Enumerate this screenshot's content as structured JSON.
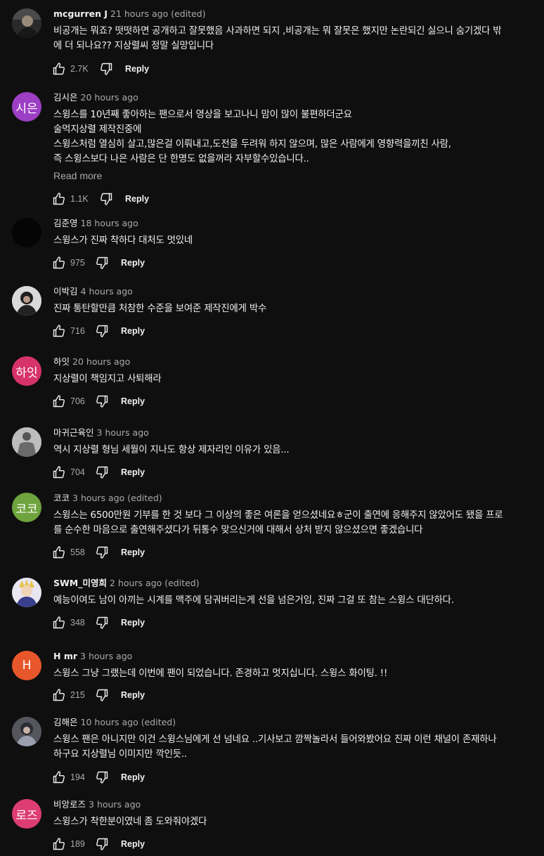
{
  "comments": [
    {
      "author": "mcgurren J",
      "time": "21 hours ago (edited)",
      "lines": [
        "비공개는 뭐죠? 떳떳하면 공개하고 잘못했음 사과하면 되지 ,비공개는 뭐 잘못은 했지만 논란되긴 싫으니 숨기겠다 밖",
        "에 더 되나요?? 지상렬씨 정말 실망입니다"
      ],
      "likes": "2.7K",
      "reply": "Reply",
      "avatar_text": "",
      "avatar_color": "#3a3a3a"
    },
    {
      "author": "김시은",
      "time": "20 hours ago",
      "lines": [
        "스윙스를 10년째 좋아하는 팬으로서 영상을 보고나니 맘이 많이 불편하더군요",
        "술먹지상렬 제작진중에",
        "스윙스처럼 열심히 살고,많은걸 이뤄내고,도전을 두려워 하지 않으며, 많은 사람에게 영향력을끼친 사람,",
        "즉 스윙스보다 나은 사람은 단 한명도 없을꺼라 자부할수있습니다.."
      ],
      "read_more": "Read more",
      "likes": "1.1K",
      "reply": "Reply",
      "avatar_text": "시은",
      "avatar_color": "#9c3fc4"
    },
    {
      "author": "김준영",
      "time": "18 hours ago",
      "lines": [
        "스윙스가 진짜 착하다 대처도 멋있네"
      ],
      "likes": "975",
      "reply": "Reply",
      "avatar_text": "",
      "avatar_color": "#050505"
    },
    {
      "author": "이박김",
      "time": "4 hours ago",
      "lines": [
        "진짜 통탄할만큼 처참한 수준을 보여준 제작진에게 박수"
      ],
      "likes": "716",
      "reply": "Reply",
      "avatar_text": "",
      "avatar_color": "#d8d8d8"
    },
    {
      "author": "하잇",
      "time": "20 hours ago",
      "lines": [
        "지상렬이 책임지고 사퇴해라"
      ],
      "likes": "706",
      "reply": "Reply",
      "avatar_text": "하잇",
      "avatar_color": "#d7336b"
    },
    {
      "author": "마귀근육인",
      "time": "3 hours ago",
      "lines": [
        "역시 지상렬 형님 세월이 지나도 항상 제자리인 이유가 있음..."
      ],
      "likes": "704",
      "reply": "Reply",
      "avatar_text": "",
      "avatar_color": "#8a8a8a"
    },
    {
      "author": "코코",
      "time": "3 hours ago (edited)",
      "lines": [
        "스윙스는 6500만원 기부를 한 것 보다 그 이상의 좋은 여론을 얻으셨네요ㅎ군이 출연에 응해주지 않았어도 됐을 프로",
        "를 순수한 마음으로 출연해주셨다가 뒤통수 맞으신거에 대해서 상처 받지 않으셨으면 좋겠습니다"
      ],
      "likes": "558",
      "reply": "Reply",
      "avatar_text": "코코",
      "avatar_color": "#6ea33d"
    },
    {
      "author": "SWM_미영희",
      "time": "2 hours ago (edited)",
      "lines": [
        "예능이여도 남이 아끼는 시계를 맥주에 담궈버리는게 선을 넘은거임, 진짜 그걸 또 참는 스윙스 대단하다."
      ],
      "likes": "348",
      "reply": "Reply",
      "avatar_text": "",
      "avatar_color": "#3b4a7a"
    },
    {
      "author": "H mr",
      "time": "3 hours ago",
      "lines": [
        "스윙스 그냥 그랬는데 이번에 팬이 되었습니다. 존경하고 멋지십니다. 스윙스 화이팅. !!"
      ],
      "likes": "215",
      "reply": "Reply",
      "avatar_text": "H",
      "avatar_color": "#e8572c"
    },
    {
      "author": "김해은",
      "time": "10 hours ago (edited)",
      "lines": [
        "스윙스 팬은 아니지만 이건 스윙스님에게 선 넘네요 ..기사보고 깜짝놀라서 들어와봤어요 진짜 이런 채널이 존재하나",
        "하구요 지상렬님 이미지만 깍인듯.."
      ],
      "likes": "194",
      "reply": "Reply",
      "avatar_text": "",
      "avatar_color": "#5a5a66"
    },
    {
      "author": "비앙로즈",
      "time": "3 hours ago",
      "lines": [
        "스윙스가 착한분이였네 좀 도와줘야겠다"
      ],
      "likes": "189",
      "reply": "Reply",
      "avatar_text": "로즈",
      "avatar_color": "#dd3d73"
    }
  ]
}
